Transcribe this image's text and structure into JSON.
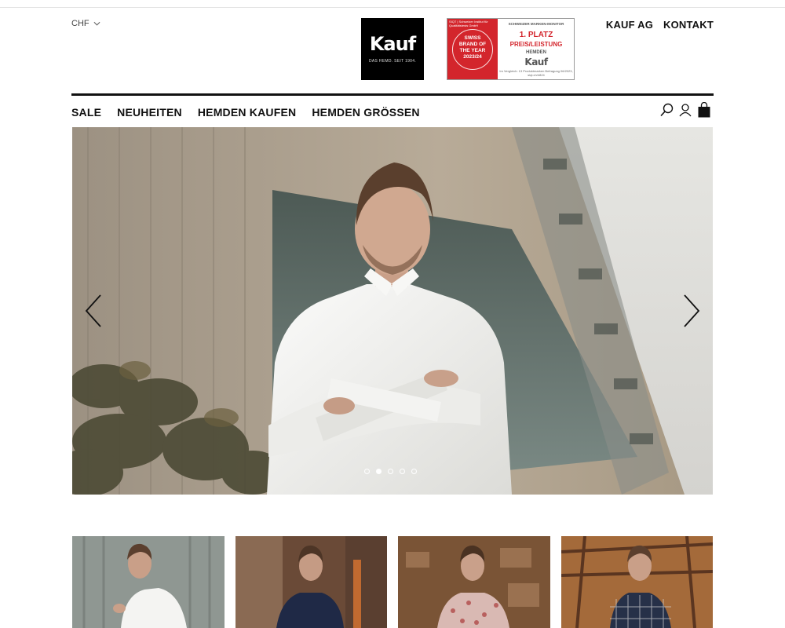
{
  "header": {
    "currency": "CHF",
    "logo": {
      "wordmark": "Kauf",
      "tagline": "DAS HEMD. SEIT 1904."
    },
    "award": {
      "issuer": "SIQT | Schweizer Institut für Qualitätstests GmbH",
      "seal_lines": [
        "SWISS",
        "BRAND OF",
        "THE YEAR",
        "2023/24"
      ],
      "monitor": "SCHWEIZER MARKEN-MONITOR",
      "place": "1. PLATZ",
      "category": "PREIS/LEISTUNG",
      "product": "HEMDEN",
      "brand": "Kauf",
      "fine_print": "Im Vergleich: 13 Produktmarken Befragung 06/2023, siqt.ch/4824"
    },
    "top_links": [
      "KAUF AG",
      "KONTAKT"
    ]
  },
  "nav": {
    "items": [
      "SALE",
      "NEUHEITEN",
      "HEMDEN KAUFEN",
      "HEMDEN GRÖSSEN"
    ],
    "icons": [
      "search-icon",
      "user-icon",
      "shopping-bag-icon"
    ]
  },
  "hero": {
    "slide_count": 5,
    "active_slide": 2,
    "shirt_color": "#f2f2f0"
  },
  "thumbnails": [
    {
      "shirt": "white"
    },
    {
      "shirt": "navy"
    },
    {
      "shirt": "red floral print"
    },
    {
      "shirt": "navy check"
    }
  ]
}
